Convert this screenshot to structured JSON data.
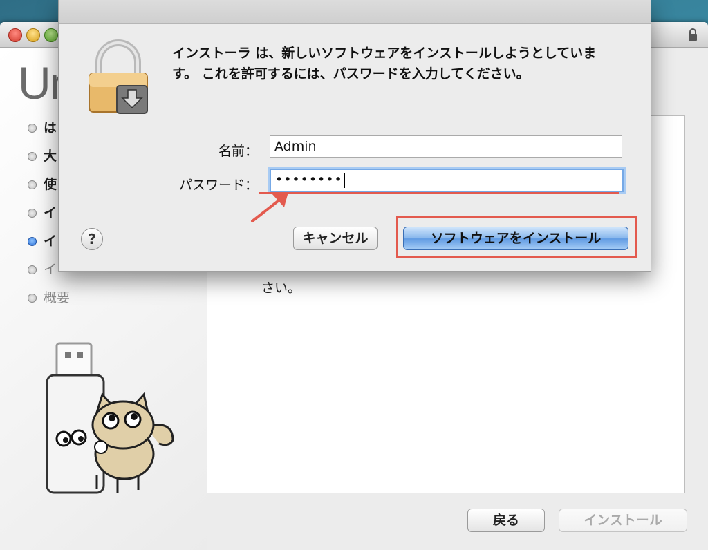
{
  "installer": {
    "heading": "Ur",
    "steps": [
      {
        "label": "は",
        "state": "done"
      },
      {
        "label": "大",
        "state": "done"
      },
      {
        "label": "使",
        "state": "done"
      },
      {
        "label": "イ",
        "state": "done"
      },
      {
        "label": "イ",
        "state": "current"
      },
      {
        "label": "イ",
        "state": "pending"
      },
      {
        "label": "概要",
        "state": "pending"
      }
    ],
    "content_text": "さい。",
    "back_button": "戻る",
    "install_button": "インストール"
  },
  "dialog": {
    "message": "インストーラ は、新しいソフトウェアをインストールしようとしています。 これを許可するには、パスワードを入力してください。",
    "name_label": "名前：",
    "name_value": "Admin",
    "password_label": "パスワード：",
    "password_masked": "••••••••",
    "help_label": "?",
    "cancel_button": "キャンセル",
    "install_software_button": "ソフトウェアをインストール"
  },
  "colors": {
    "annotation_red": "#e35a4e",
    "focus_blue": "#76a9e6",
    "default_button_blue": "#5f9ae2"
  }
}
